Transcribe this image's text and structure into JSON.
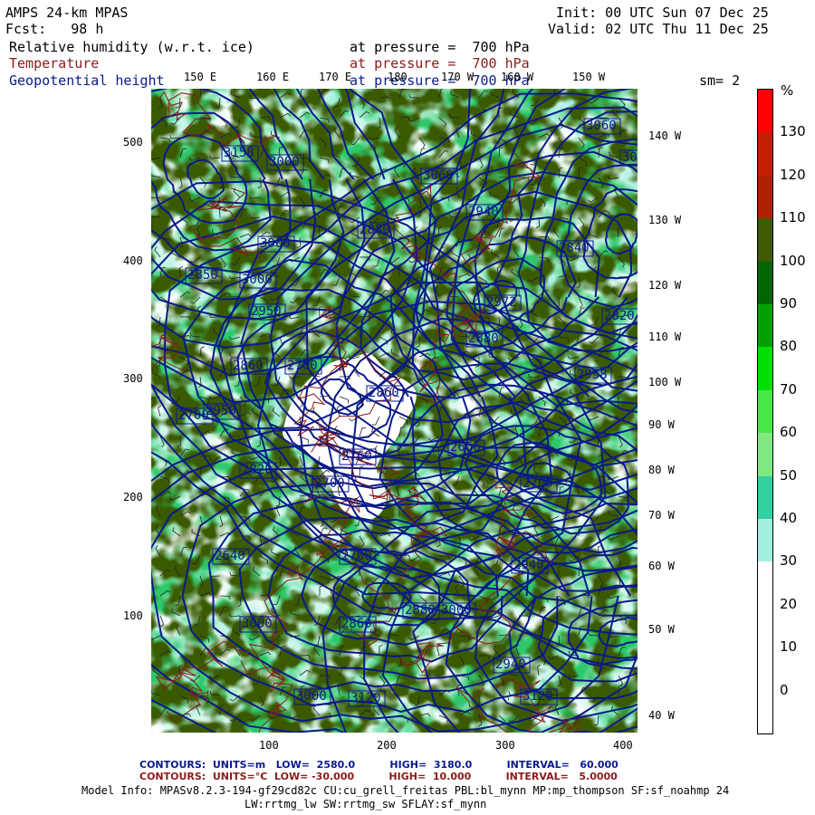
{
  "header": {
    "title_line1": "AMPS 24-km MPAS",
    "title_line2": "Fcst:   98 h",
    "init": "Init: 00 UTC Sun 07 Dec 25",
    "valid": "Valid: 02 UTC Thu 11 Dec 25",
    "field1_name": "Relative humidity (w.r.t. ice)",
    "field1_level": "at pressure =  700 hPa",
    "field2_name": "Temperature",
    "field2_level": "at pressure =  700 hPa",
    "field3_name": "Geopotential height",
    "field3_level": "at pressure =  700 hPa",
    "smoothing": "sm= 2",
    "colors": {
      "field1": "#000000",
      "field2": "#8b1a1a",
      "field3": "#0a1a8a"
    }
  },
  "top_lon_labels": [
    "150 E",
    "160 E",
    "170 E",
    "180",
    "170 W",
    "160 W",
    "150 W"
  ],
  "right_lon_labels": [
    "140 W",
    "130 W",
    "120 W",
    "110 W",
    "100 W",
    "90 W",
    "80 W",
    "70 W",
    "60 W",
    "50 W",
    "40 W"
  ],
  "y_axis_ticks": [
    "500",
    "400",
    "300",
    "200",
    "100"
  ],
  "x_axis_ticks": [
    "100",
    "200",
    "300",
    "400"
  ],
  "colorbar": {
    "unit": "%",
    "labels": [
      "130",
      "120",
      "110",
      "100",
      "90",
      "80",
      "70",
      "60",
      "50",
      "40",
      "30",
      "20",
      "10",
      "0"
    ],
    "colors": [
      "#ff0000",
      "#c42000",
      "#b02000",
      "#3f5a00",
      "#006400",
      "#00a000",
      "#00e000",
      "#48e848",
      "#80e880",
      "#30d0a0",
      "#a0f0e0",
      "#ffffff",
      "#ffffff",
      "#ffffff",
      "#ffffff"
    ]
  },
  "height_labels": [
    "3158",
    "3000",
    "3060",
    "2940",
    "3000",
    "2880",
    "2850",
    "3000",
    "3060",
    "3000",
    "2840",
    "2820",
    "2972",
    "2880",
    "2950",
    "2860",
    "2700",
    "2860",
    "2820",
    "2700",
    "2666",
    "2760",
    "2700",
    "2700",
    "2940",
    "2700",
    "2640",
    "2880",
    "2860",
    "3000",
    "2940",
    "3000",
    "3120",
    "3000",
    "3120",
    "2950",
    "2958"
  ],
  "footer": {
    "height_contours": "CONTOURS:  UNITS=m   LOW=  2580.0          HIGH=  3180.0          INTERVAL=   60.000",
    "temp_contours": "CONTOURS:  UNITS=°C  LOW= -30.000          HIGH=  10.000          INTERVAL=   5.0000",
    "model_info_1": "Model Info: MPASv8.2.3-194-gf29cd82c CU:cu_grell_freitas PBL:bl_mynn MP:mp_thompson SF:sf_noahmp 24",
    "model_info_2": "LW:rrtmg_lw SW:rrtmg_sw SFLAY:sf_mynn",
    "colors": {
      "height": "#0a1a8a",
      "temp": "#8b1a1a"
    }
  }
}
